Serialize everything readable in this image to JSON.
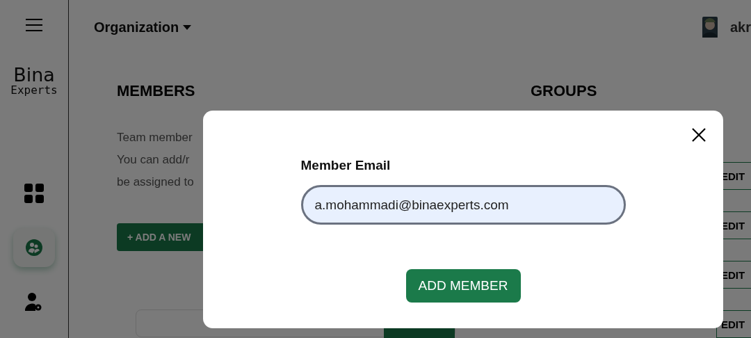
{
  "sidebar": {
    "items": [
      {
        "kind": "grid",
        "selected": false
      },
      {
        "kind": "team",
        "selected": true
      },
      {
        "kind": "user-settings",
        "selected": false
      }
    ]
  },
  "logo": {
    "top": "Bina",
    "bottom": "Experts"
  },
  "header": {
    "org_menu": "Organization",
    "user_name": "akr"
  },
  "members": {
    "title": "MEMBERS",
    "lines": [
      "Team member",
      "You can add/r",
      "be assigned to"
    ],
    "add_button": "+ ADD A NEW"
  },
  "groups": {
    "title": "GROUPS",
    "edit_buttons": [
      "EDIT",
      "EDIT",
      "EDIT",
      "EDIT"
    ]
  },
  "modal": {
    "label": "Member Email",
    "value": "a.mohammadi@binaexperts.com",
    "button": "ADD MEMBER"
  }
}
